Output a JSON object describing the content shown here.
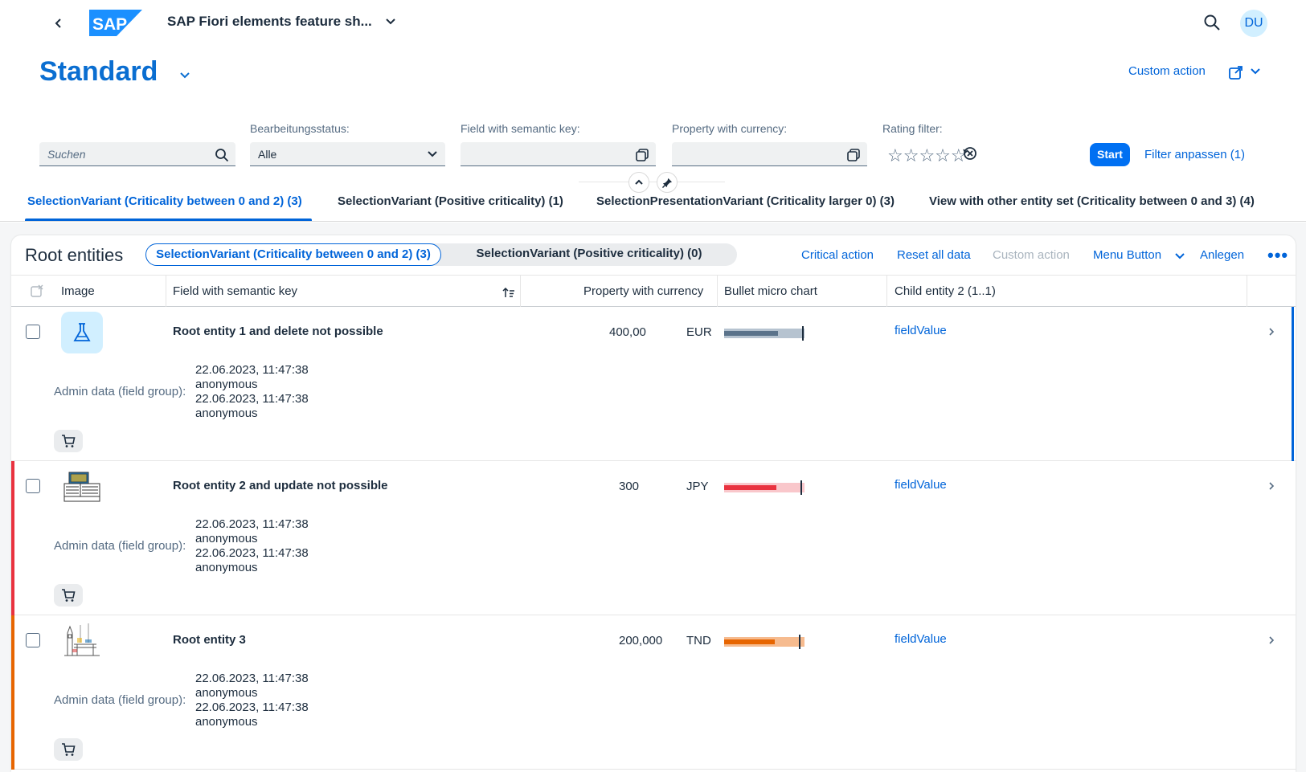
{
  "shell": {
    "app_title": "SAP Fiori elements feature sh...",
    "avatar_initials": "DU",
    "logo_text": "SAP"
  },
  "header": {
    "variant_title": "Standard",
    "custom_action": "Custom action"
  },
  "filters": {
    "search_placeholder": "Suchen",
    "editing_status_label": "Bearbeitungsstatus:",
    "editing_status_value": "Alle",
    "semantic_key_label": "Field with semantic key:",
    "currency_label": "Property with currency:",
    "rating_label": "Rating filter:",
    "rating_stars": "☆☆☆☆☆",
    "start_label": "Start",
    "adapt_label": "Filter anpassen (1)"
  },
  "tabs": [
    {
      "label": "SelectionVariant (Criticality between 0 and 2) (3)",
      "active": true
    },
    {
      "label": "SelectionVariant (Positive criticality) (1)",
      "active": false
    },
    {
      "label": "SelectionPresentationVariant (Criticality larger 0) (3)",
      "active": false
    },
    {
      "label": "View with other entity set (Criticality between 0 and 3) (4)",
      "active": false
    }
  ],
  "table": {
    "title": "Root entities",
    "segments": [
      {
        "label": "SelectionVariant (Criticality between 0 and 2) (3)",
        "active": true
      },
      {
        "label": "SelectionVariant (Positive criticality) (0)",
        "active": false
      }
    ],
    "toolbar": {
      "critical_action": "Critical action",
      "reset_all": "Reset all data",
      "custom_action": "Custom action",
      "menu_button": "Menu Button",
      "create": "Anlegen",
      "overflow": "•••"
    },
    "columns": [
      "Image",
      "Field with semantic key",
      "Property with currency",
      "Bullet micro chart",
      "Child entity 2 (1..1)"
    ],
    "rows": [
      {
        "title": "Root entity 1 and delete not possible",
        "amount": "400,00",
        "currency": "EUR",
        "bullet_value_pct": 67,
        "criticality_color": "#5b738b",
        "bullet_bg": "#b6c3d0",
        "bullet_fill": "#5b738b",
        "field_value": "fieldValue",
        "admin_label": "Admin data (field group):",
        "admin_created_at": "22.06.2023, 11:47:38",
        "admin_created_by": "anonymous",
        "admin_changed_at": "22.06.2023, 11:47:38",
        "admin_changed_by": "anonymous",
        "image": "flask-icon",
        "selected_indicator": true,
        "crit_bar": null
      },
      {
        "title": "Root entity 2 and update not possible",
        "amount": "300",
        "currency": "JPY",
        "bullet_value_pct": 65,
        "criticality_color": "#e9323f",
        "bullet_bg": "#f9c7cb",
        "bullet_fill": "#e9323f",
        "field_value": "fieldValue",
        "admin_label": "Admin data (field group):",
        "admin_created_at": "22.06.2023, 11:47:38",
        "admin_created_by": "anonymous",
        "admin_changed_at": "22.06.2023, 11:47:38",
        "admin_changed_by": "anonymous",
        "image": "containers-picture",
        "selected_indicator": false,
        "crit_bar": "#e9323f"
      },
      {
        "title": "Root entity 3",
        "amount": "200,000",
        "currency": "TND",
        "bullet_value_pct": 63,
        "criticality_color": "#e76500",
        "bullet_bg": "#f6bb8f",
        "bullet_fill": "#e76500",
        "field_value": "fieldValue",
        "admin_label": "Admin data (field group):",
        "admin_created_at": "22.06.2023, 11:47:38",
        "admin_created_by": "anonymous",
        "admin_changed_at": "22.06.2023, 11:47:38",
        "admin_changed_by": "anonymous",
        "image": "london-sketch-picture",
        "selected_indicator": false,
        "crit_bar": "#e76500"
      }
    ]
  },
  "colors": {
    "accent": "#0064d9",
    "title_blue": "#0a6ed1",
    "text": "#1d2d3e",
    "label": "#556b82"
  }
}
